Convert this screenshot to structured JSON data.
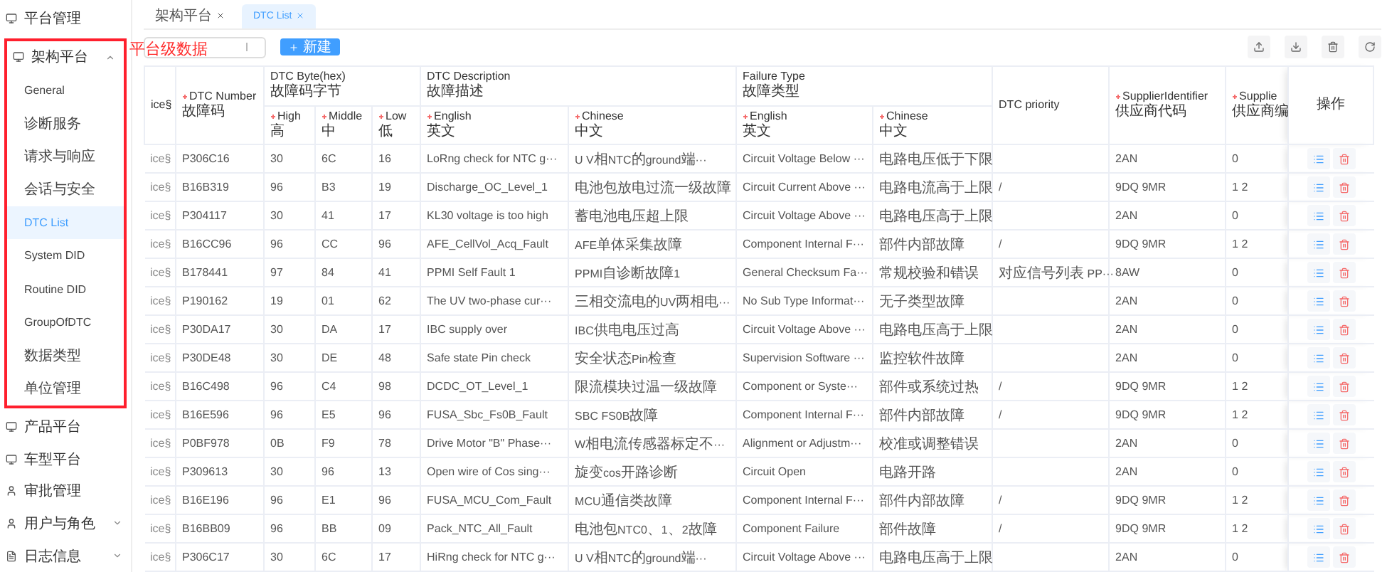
{
  "sidebar": {
    "items": [
      {
        "label": "平台管理",
        "kind": "platform"
      },
      {
        "label": "架构平台",
        "kind": "platform",
        "expanded": true,
        "annotation": "平台级数据",
        "children": [
          {
            "label": "General",
            "selected": false
          },
          {
            "label": "诊断服务",
            "selected": false
          },
          {
            "label": "请求与响应",
            "selected": false
          },
          {
            "label": "会话与安全",
            "selected": false
          },
          {
            "label": "DTC List",
            "selected": true
          },
          {
            "label": "System DID",
            "selected": false
          },
          {
            "label": "Routine DID",
            "selected": false
          },
          {
            "label": "GroupOfDTC",
            "selected": false
          },
          {
            "label": "数据类型",
            "selected": false
          },
          {
            "label": "单位管理",
            "selected": false
          }
        ]
      },
      {
        "label": "产品平台",
        "kind": "platform"
      },
      {
        "label": "车型平台",
        "kind": "platform"
      },
      {
        "label": "审批管理",
        "kind": "user"
      },
      {
        "label": "用户与角色",
        "kind": "user",
        "expanded": false
      },
      {
        "label": "日志信息",
        "kind": "log",
        "expanded": false
      }
    ]
  },
  "tabs": [
    {
      "label": "架构平台",
      "selected": false
    },
    {
      "label": "DTC List",
      "selected": true
    }
  ],
  "toolbar": {
    "new_button": "新建"
  },
  "table": {
    "columns": [
      {
        "kind": "single",
        "label": "ice§"
      },
      {
        "kind": "single",
        "label": "DTC Number",
        "sublabel": "故障码",
        "required": true
      },
      {
        "kind": "group",
        "label": "DTC Byte(hex)",
        "sublabel": "故障码字节",
        "colspan": 3,
        "children": [
          {
            "label": "High",
            "sublabel": "高",
            "required": true
          },
          {
            "label": "Middle",
            "sublabel": "中",
            "required": true
          },
          {
            "label": "Low",
            "sublabel": "低",
            "required": true
          }
        ]
      },
      {
        "kind": "group",
        "label": "DTC Description",
        "sublabel": "故障描述",
        "colspan": 2,
        "children": [
          {
            "label": "English",
            "sublabel": "英文",
            "required": true
          },
          {
            "label": "Chinese",
            "sublabel": "中文",
            "required": true
          }
        ]
      },
      {
        "kind": "group",
        "label": "Failure Type",
        "sublabel": "故障类型",
        "colspan": 2,
        "children": [
          {
            "label": "English",
            "sublabel": "英文",
            "required": true
          },
          {
            "label": "Chinese",
            "sublabel": "中文",
            "required": true
          }
        ]
      },
      {
        "kind": "single",
        "label": "DTC priority",
        "required": false
      },
      {
        "kind": "single",
        "label": "SupplierIdentifier",
        "sublabel": "供应商代码",
        "required": true
      },
      {
        "kind": "single",
        "label": "Supplie",
        "sublabel": "供应商编",
        "required": true
      },
      {
        "kind": "actions",
        "label": "操作"
      }
    ],
    "rows": [
      [
        "ice§",
        "P306C16",
        "30",
        "6C",
        "16",
        "LoRng check for NTC g···",
        "U V相NTC的ground端···",
        "Circuit Voltage Below ···",
        "电路电压低于下限",
        null,
        "2AN",
        "0"
      ],
      [
        "ice§",
        "B16B319",
        "96",
        "B3",
        "19",
        "Discharge_OC_Level_1",
        "电池包放电过流一级故障",
        "Circuit Current Above ···",
        "电路电流高于上限",
        "/",
        "9DQ 9MR",
        "1 2"
      ],
      [
        "ice§",
        "P304117",
        "30",
        "41",
        "17",
        "KL30 voltage is too high",
        "蓄电池电压超上限",
        "Circuit Voltage Above ···",
        "电路电压高于上限",
        null,
        "2AN",
        "0"
      ],
      [
        "ice§",
        "B16CC96",
        "96",
        "CC",
        "96",
        "AFE_CellVol_Acq_Fault",
        "AFE单体采集故障",
        "Component Internal F···",
        "部件内部故障",
        "/",
        "9DQ 9MR",
        "1 2"
      ],
      [
        "ice§",
        "B178441",
        "97",
        "84",
        "41",
        "PPMI Self Fault 1",
        "PPMI自诊断故障1",
        "General Checksum Fa···",
        "常规校验和错误",
        "对应信号列表 PP···",
        "8AW",
        "0"
      ],
      [
        "ice§",
        "P190162",
        "19",
        "01",
        "62",
        "The UV two-phase cur···",
        "三相交流电的UV两相电···",
        "No Sub Type Informat···",
        "无子类型故障",
        null,
        "2AN",
        "0"
      ],
      [
        "ice§",
        "P30DA17",
        "30",
        "DA",
        "17",
        "IBC supply over",
        "IBC供电电压过高",
        "Circuit Voltage Above ···",
        "电路电压高于上限",
        null,
        "2AN",
        "0"
      ],
      [
        "ice§",
        "P30DE48",
        "30",
        "DE",
        "48",
        "Safe state Pin check",
        "安全状态Pin检查",
        "Supervision Software ···",
        "监控软件故障",
        null,
        "2AN",
        "0"
      ],
      [
        "ice§",
        "B16C498",
        "96",
        "C4",
        "98",
        "DCDC_OT_Level_1",
        "限流模块过温一级故障",
        "Component or Syste···",
        "部件或系统过热",
        "/",
        "9DQ 9MR",
        "1 2"
      ],
      [
        "ice§",
        "B16E596",
        "96",
        "E5",
        "96",
        "FUSA_Sbc_Fs0B_Fault",
        "SBC FS0B故障",
        "Component Internal F···",
        "部件内部故障",
        "/",
        "9DQ 9MR",
        "1 2"
      ],
      [
        "ice§",
        "P0BF978",
        "0B",
        "F9",
        "78",
        "Drive Motor \"B\" Phase···",
        "W相电流传感器标定不···",
        "Alignment or Adjustm···",
        "校准或调整错误",
        null,
        "2AN",
        "0"
      ],
      [
        "ice§",
        "P309613",
        "30",
        "96",
        "13",
        "Open wire of Cos sing···",
        "旋变cos开路诊断",
        "Circuit Open",
        "电路开路",
        null,
        "2AN",
        "0"
      ],
      [
        "ice§",
        "B16E196",
        "96",
        "E1",
        "96",
        "FUSA_MCU_Com_Fault",
        "MCU通信类故障",
        "Component Internal F···",
        "部件内部故障",
        "/",
        "9DQ 9MR",
        "1 2"
      ],
      [
        "ice§",
        "B16BB09",
        "96",
        "BB",
        "09",
        "Pack_NTC_All_Fault",
        "电池包NTC0、1、2故障",
        "Component Failure",
        "部件故障",
        "/",
        "9DQ 9MR",
        "1 2"
      ],
      [
        "ice§",
        "P306C17",
        "30",
        "6C",
        "17",
        "HiRng check for NTC g···",
        "U V相NTC的ground端···",
        "Circuit Voltage Above ···",
        "电路电压高于上限",
        null,
        "2AN",
        "0"
      ]
    ]
  }
}
